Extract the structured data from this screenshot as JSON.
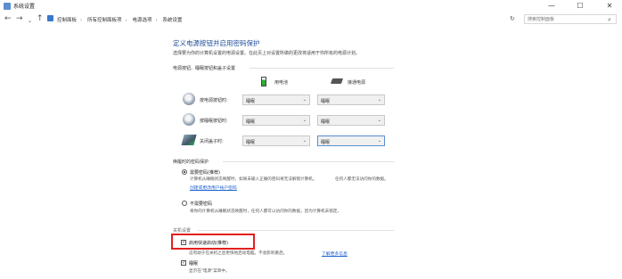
{
  "window": {
    "title": "系统设置",
    "minimize": "—",
    "maximize": "☐",
    "close": "✕"
  },
  "address": {
    "back": "←",
    "forward": "→",
    "up": "↑",
    "dropdown": "⌄",
    "crumbs": [
      "控制面板",
      "所有控制面板项",
      "电源选项",
      "系统设置"
    ],
    "separator": "›",
    "refresh": "↻",
    "search_placeholder": "搜索控制面板"
  },
  "page": {
    "title": "定义电源按钮并启用密码保护",
    "description": "选择要为你的计算机设置的电源设置。在此页上对设置所做的更改将适用于你所有的电源计划。"
  },
  "buttons_section": {
    "label": "电源按钮、睡眠按钮和盖子设置",
    "col_battery": "用电池",
    "col_plugged": "接通电源",
    "rows": [
      {
        "label": "按电源按钮时:",
        "battery": "睡眠",
        "plugged": "睡眠"
      },
      {
        "label": "按睡眠按钮时:",
        "battery": "睡眠",
        "plugged": "睡眠"
      },
      {
        "label": "关闭盖子时:",
        "battery": "睡眠",
        "plugged": "睡眠"
      }
    ]
  },
  "wake_section": {
    "label": "唤醒时的密码保护",
    "require": {
      "title": "需要密码(推荐)",
      "desc1": "计算机从睡眠状态唤醒时，如果未输入正确的密码将无法解锁计算机。",
      "desc2": "任何人都无法访问你的数据。",
      "link": "创建或更改用户帐户密码"
    },
    "no_require": {
      "title": "不需要密码",
      "desc": "将你的计算机从睡眠状态唤醒时，任何人都可以访问你的数据，因为计算机未锁定。"
    }
  },
  "shutdown_section": {
    "label": "关机设置",
    "fast_startup": {
      "title": "启用快速启动(推荐)",
      "desc": "这有助于在关机之后更快地启动电脑。不会影响重启。",
      "link": "了解更多信息"
    },
    "sleep": {
      "title": "睡眠",
      "desc": "显示在\"电源\"菜单中。"
    }
  }
}
